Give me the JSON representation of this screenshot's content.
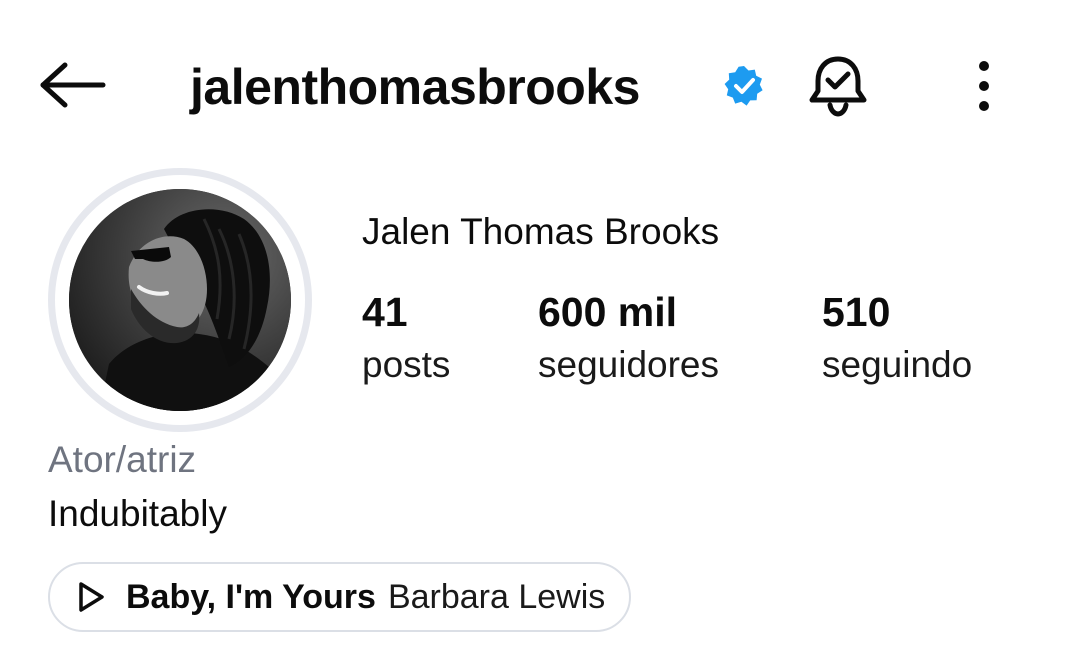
{
  "header": {
    "username": "jalenthomasbrooks",
    "back_icon": "arrow-left-icon",
    "verified_icon": "verified-badge-icon",
    "bell_icon": "bell-check-icon",
    "more_icon": "more-vertical-icon"
  },
  "profile": {
    "display_name": "Jalen Thomas Brooks",
    "avatar_alt": "profile-photo",
    "stats": [
      {
        "value": "41",
        "label": "posts"
      },
      {
        "value": "600 mil",
        "label": "seguidores"
      },
      {
        "value": "510",
        "label": "seguindo"
      }
    ],
    "category": "Ator/atriz",
    "bio": "Indubitably",
    "music": {
      "title": "Baby, I'm Yours",
      "artist": "Barbara Lewis",
      "icon": "play-icon"
    }
  },
  "colors": {
    "verified_blue": "#1d9bf0",
    "ring": "#e6e8ee",
    "category_gray": "#6f7480",
    "pill_border": "#dbdfe6"
  }
}
